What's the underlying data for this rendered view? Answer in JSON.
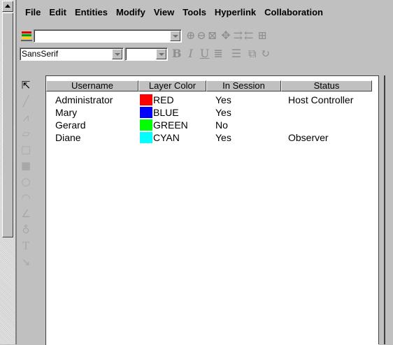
{
  "menu": [
    "File",
    "Edit",
    "Entities",
    "Modify",
    "View",
    "Tools",
    "Hyperlink",
    "Collaboration"
  ],
  "toolbar": {
    "layer_combo_value": "",
    "font_combo_value": "SansSerif",
    "size_combo_value": "",
    "text_buttons": {
      "bold": "B",
      "italic": "I",
      "underline": "U"
    }
  },
  "palette_tools": [
    "select-arrow",
    "line",
    "polyline",
    "polygon",
    "rectangle",
    "filled-rectangle",
    "circle",
    "arc",
    "curve",
    "lasso",
    "text",
    "dimension"
  ],
  "table": {
    "columns": [
      "Username",
      "Layer Color",
      "In Session",
      "Status"
    ],
    "rows": [
      {
        "username": "Administrator",
        "color_name": "RED",
        "color": "#ff0000",
        "in_session": "Yes",
        "status": "Host Controller"
      },
      {
        "username": "Mary",
        "color_name": "BLUE",
        "color": "#0000ff",
        "in_session": "Yes",
        "status": ""
      },
      {
        "username": "Gerard",
        "color_name": "GREEN",
        "color": "#00ff00",
        "in_session": "No",
        "status": ""
      },
      {
        "username": "Diane",
        "color_name": "CYAN",
        "color": "#00ffff",
        "in_session": "Yes",
        "status": "Observer"
      }
    ]
  }
}
